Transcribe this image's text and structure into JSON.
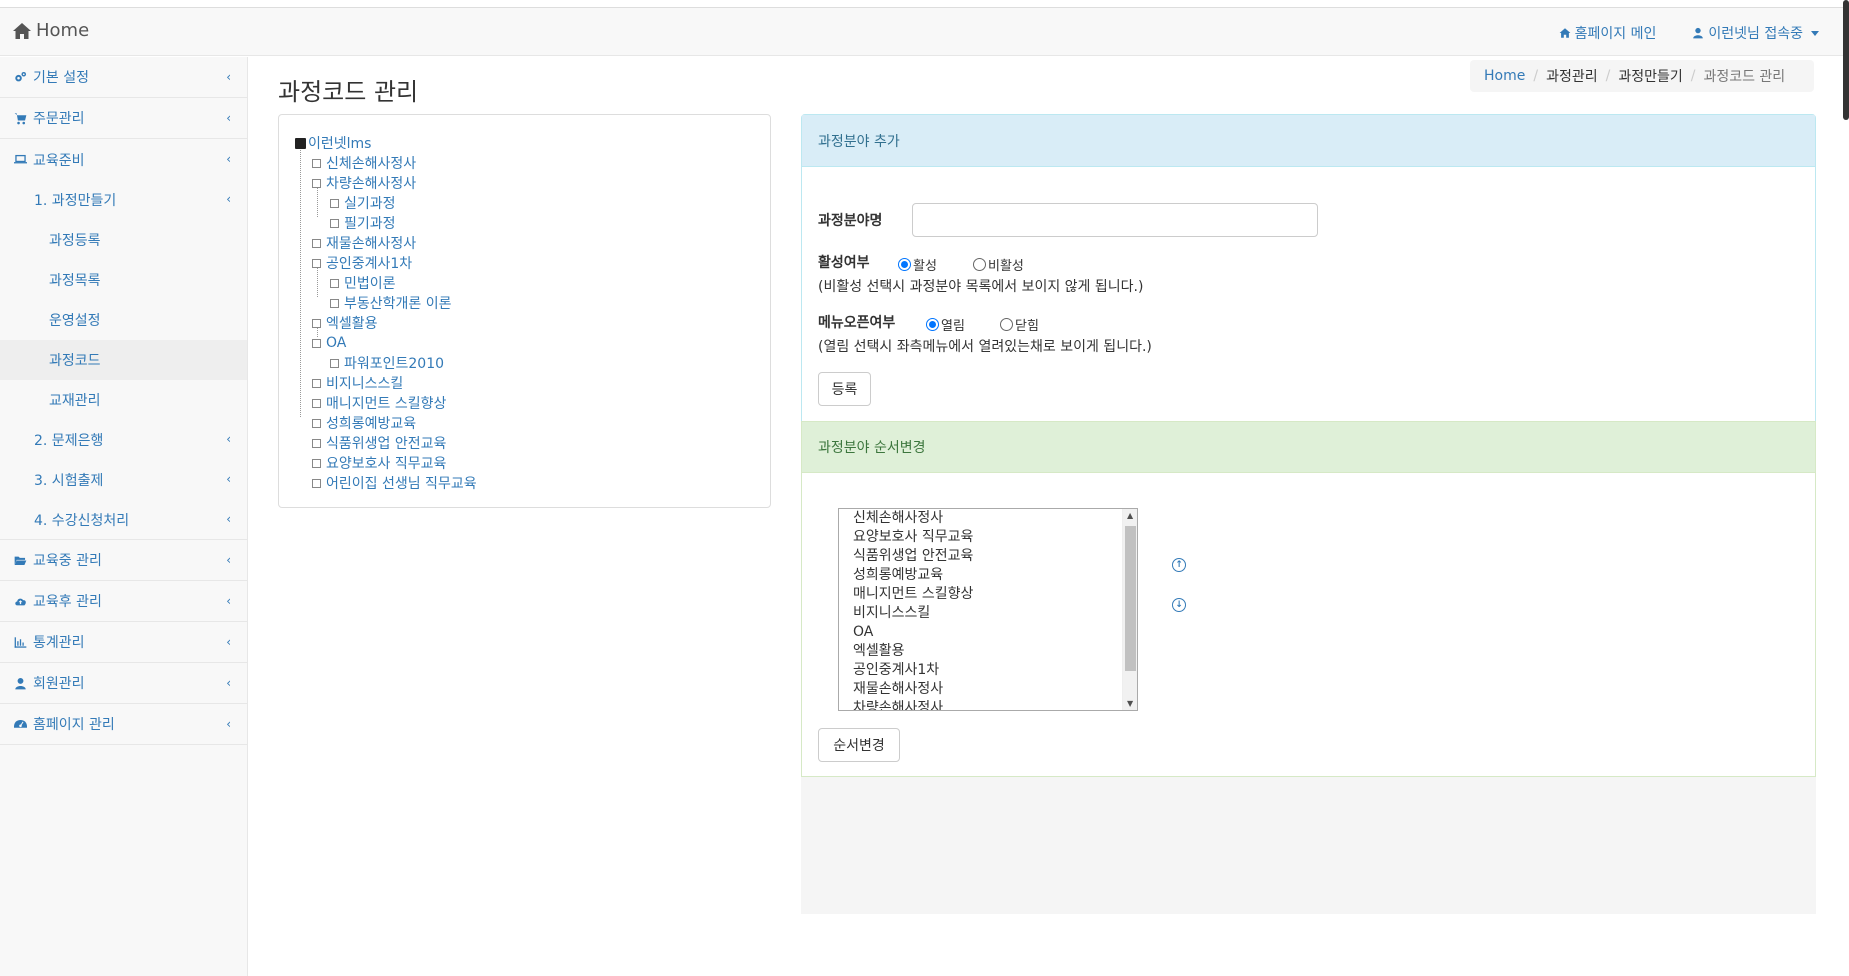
{
  "navbar": {
    "brand": "Home",
    "homepage_main": "홈페이지 메인",
    "user_status": "이런넷님 접속중"
  },
  "sidebar": {
    "items": [
      {
        "label": "기본 설정",
        "icon": "gears-icon"
      },
      {
        "label": "주문관리",
        "icon": "cart-icon"
      },
      {
        "label": "교육준비",
        "icon": "laptop-icon"
      }
    ],
    "sub": {
      "course_make": "1. 과정만들기",
      "course_make_children": [
        "과정등록",
        "과정목록",
        "운영설정",
        "과정코드",
        "교재관리"
      ],
      "question_bank": "2. 문제은행",
      "exam": "3. 시험출제",
      "enroll": "4. 수강신청처리"
    },
    "items_after": [
      {
        "label": "교육중 관리",
        "icon": "folder-open-icon"
      },
      {
        "label": "교육후 관리",
        "icon": "cloud-upload-icon"
      },
      {
        "label": "통계관리",
        "icon": "bar-chart-icon"
      },
      {
        "label": "회원관리",
        "icon": "user-icon"
      },
      {
        "label": "홈페이지 관리",
        "icon": "dashboard-icon"
      }
    ]
  },
  "page": {
    "title": "과정코드 관리",
    "breadcrumb": [
      "Home",
      "과정관리",
      "과정만들기",
      "과정코드 관리"
    ]
  },
  "tree": {
    "root": "이런넷lms",
    "nodes": [
      "신체손해사정사",
      "차량손해사정사",
      "실기과정",
      "필기과정",
      "재물손해사정사",
      "공인중계사1차",
      "민법이론",
      "부동산학개론 이론",
      "엑셀활용",
      "OA",
      "파워포인트2010",
      "비지니스스킬",
      "매니지먼트 스킬향상",
      "성희롱예방교육",
      "식품위생업 안전교육",
      "요양보호사 직무교육",
      "어린이집 선생님 직무교육"
    ]
  },
  "add_panel": {
    "heading": "과정분야 추가",
    "name_label": "과정분야명",
    "name_value": "",
    "active_label": "활성여부",
    "active_on": "활성",
    "active_off": "비활성",
    "active_help": "(비활성 선택시 과정분야 목록에서 보이지 않게 됩니다.)",
    "menu_label": "메뉴오픈여부",
    "menu_open": "열림",
    "menu_close": "닫힘",
    "menu_help": "(열림 선택시 좌측메뉴에서 열려있는채로 보이게 됩니다.)",
    "submit": "등록"
  },
  "order_panel": {
    "heading": "과정분야 순서변경",
    "options": [
      "신체손해사정사",
      "요양보호사 직무교육",
      "식품위생업 안전교육",
      "성희롱예방교육",
      "매니지먼트 스킬향상",
      "비지니스스킬",
      "OA",
      "엑셀활용",
      "공인중계사1차",
      "재물손해사정사",
      "차량손해사정사"
    ],
    "submit": "순서변경"
  }
}
